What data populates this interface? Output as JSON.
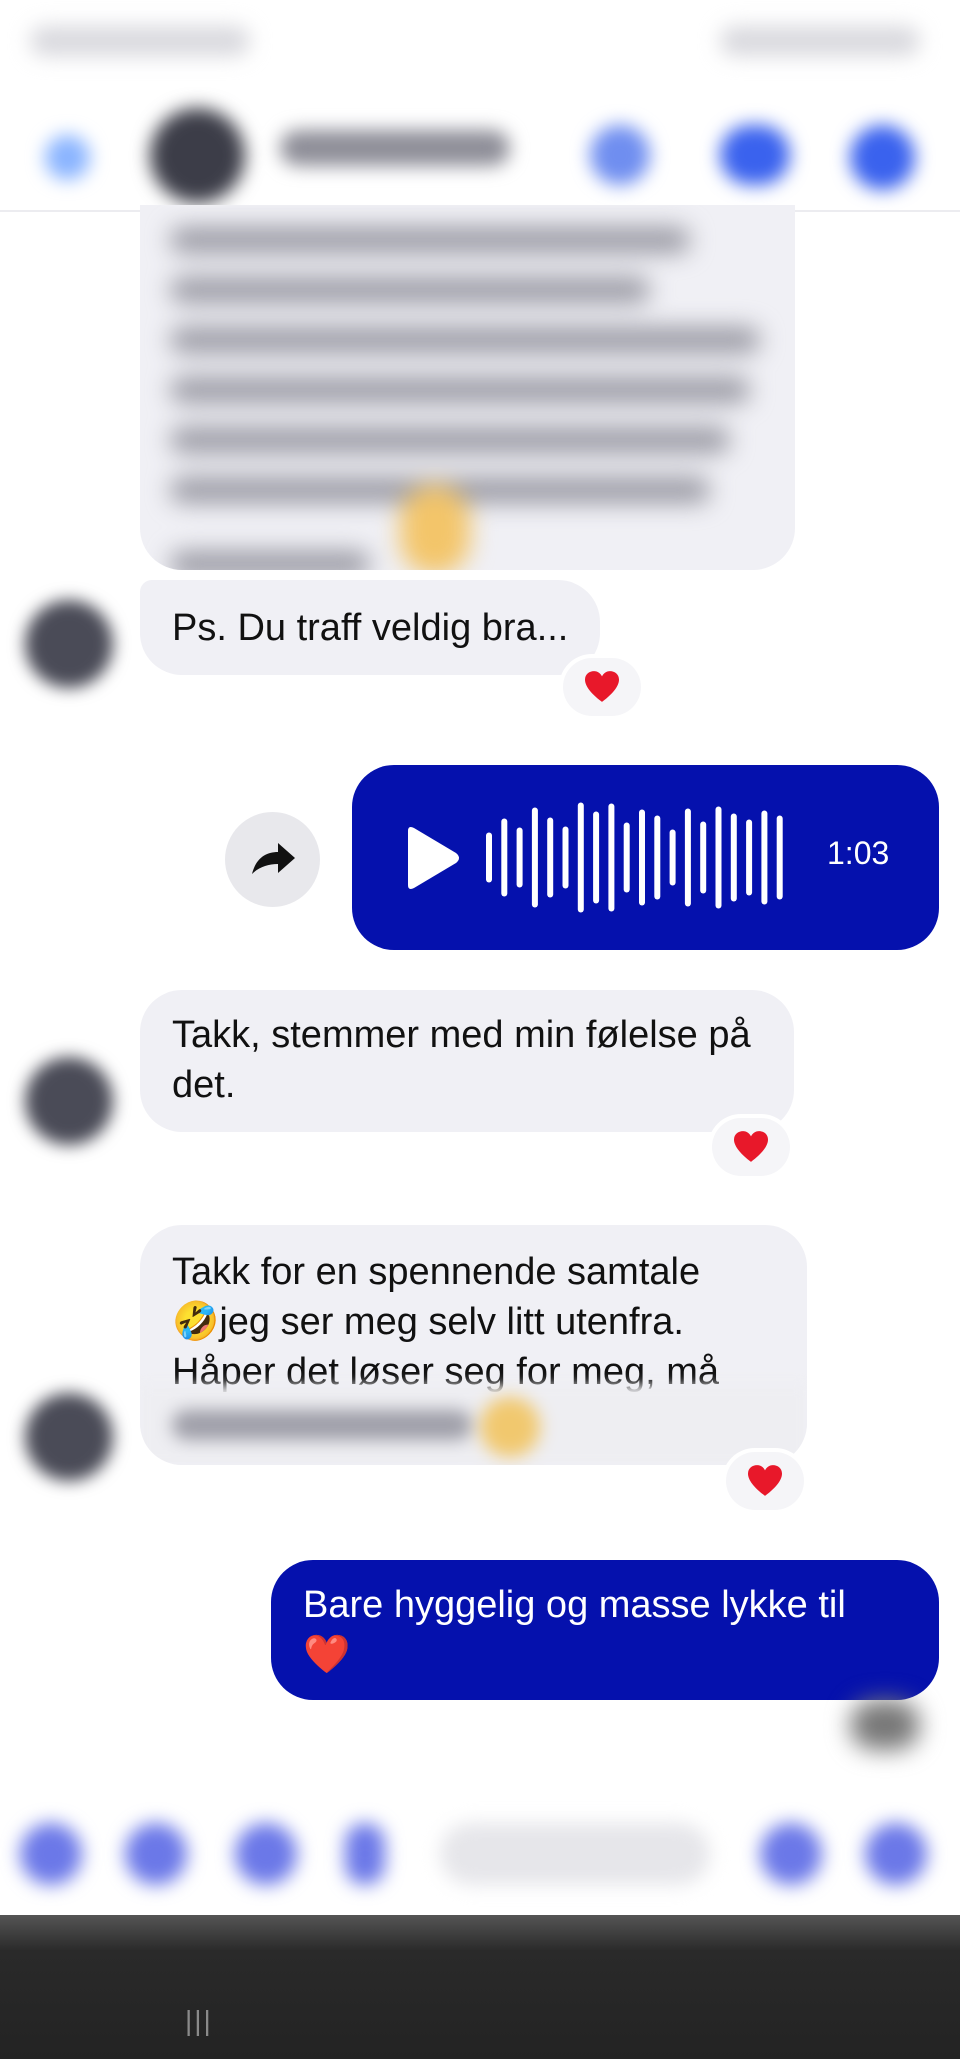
{
  "header": {
    "contact_name": "",
    "back_icon": "back-arrow-icon",
    "call_icon": "phone-icon",
    "video_icon": "video-camera-icon",
    "info_icon": "info-icon"
  },
  "messages": [
    {
      "id": "m1",
      "direction": "incoming",
      "text": "",
      "blurred": true
    },
    {
      "id": "m2",
      "direction": "incoming",
      "text": "Ps. Du traff veldig bra...",
      "reaction": "❤️"
    },
    {
      "id": "m3",
      "direction": "outgoing",
      "type": "voice",
      "duration": "1:03",
      "play_icon": "play-icon",
      "share_icon": "share-arrow-icon"
    },
    {
      "id": "m4",
      "direction": "incoming",
      "text": "Takk, stemmer med min følelse på det.",
      "reaction": "❤️"
    },
    {
      "id": "m5",
      "direction": "incoming",
      "line1": "Takk for en spennende samtale",
      "line2": "🤣jeg ser meg selv litt utenfra.",
      "line3": "Håper det løser seg for meg, må",
      "reaction": "❤️"
    },
    {
      "id": "m6",
      "direction": "outgoing",
      "text": "Bare hyggelig og masse lykke til",
      "emoji": "❤️"
    }
  ],
  "colors": {
    "outgoing_bubble": "#0511ad",
    "incoming_bubble": "#f0f0f5",
    "heart": "#e8182a"
  },
  "navbar": {
    "recent_apps_glyph": "|||"
  }
}
